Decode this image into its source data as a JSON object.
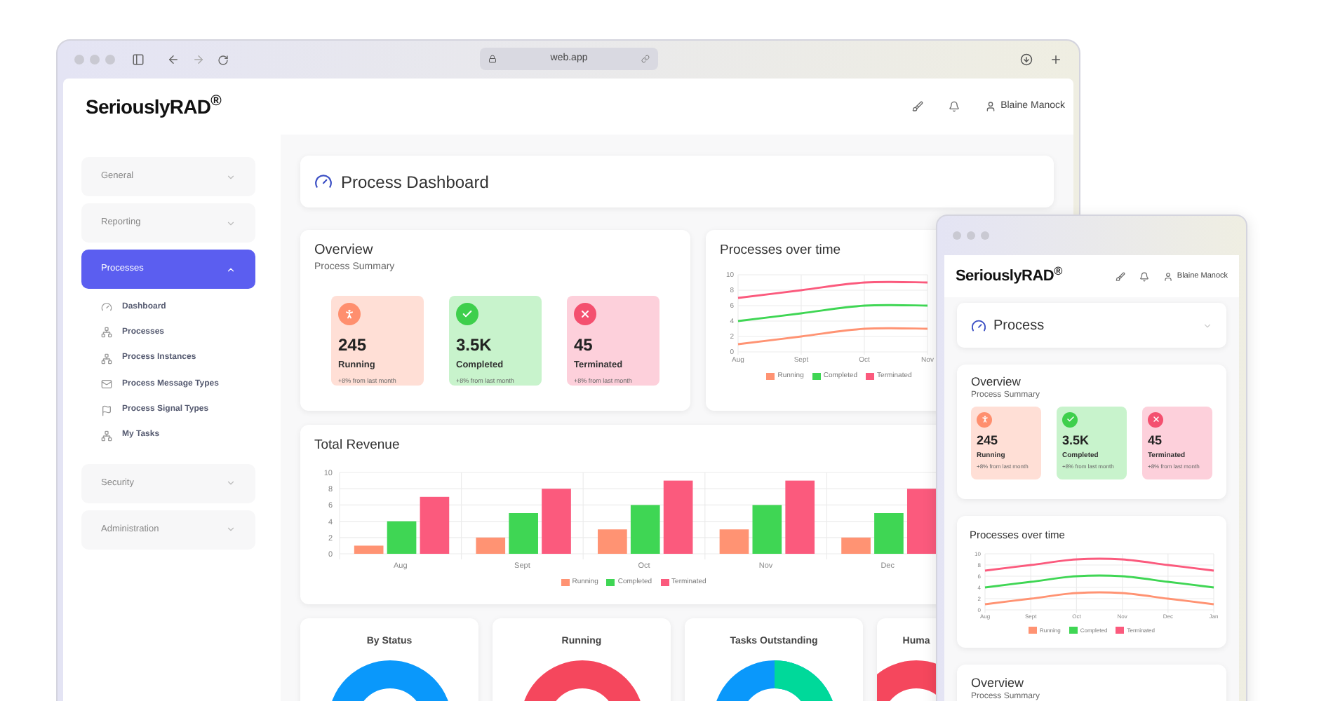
{
  "desktop_window": {
    "address_bar": "web.app",
    "header": {
      "logo": "SeriouslyRAD$^{®}$",
      "user_name": "Blaine Manock"
    },
    "sidebar": {
      "sections": [
        {
          "label": "General",
          "selected": false,
          "expanded": false
        },
        {
          "label": "Reporting",
          "selected": false,
          "expanded": false
        },
        {
          "label": "Processes",
          "selected": true,
          "expanded": true,
          "children": [
            {
              "label": "Dashboard",
              "kind": "gauge"
            },
            {
              "label": "Processes",
              "kind": "hierarchy"
            },
            {
              "label": "Process Instances",
              "kind": "hierarchy"
            },
            {
              "label": "Process Message Types",
              "kind": "mail"
            },
            {
              "label": "Process Signal Types",
              "kind": "flag"
            },
            {
              "label": "My Tasks",
              "kind": "hierarchy"
            }
          ]
        },
        {
          "label": "Security",
          "selected": false,
          "expanded": false
        },
        {
          "label": "Administration",
          "selected": false,
          "expanded": false
        }
      ]
    },
    "page_title": "Process Dashboard",
    "overview": {
      "title": "Overview",
      "subtitle": "Process Summary",
      "stats": [
        {
          "kind": "running",
          "value": "245",
          "label": "Running",
          "change": "+8% from last month"
        },
        {
          "kind": "completed",
          "value": "3.5K",
          "label": "Completed",
          "change": "+8% from last month"
        },
        {
          "kind": "terminated",
          "value": "45",
          "label": "Terminated",
          "change": "+8% from last month"
        }
      ]
    },
    "processes_chart": {
      "title": "Processes over time",
      "chart_data": {
        "type": "line",
        "grid": true,
        "categories": [
          "Aug",
          "Sept",
          "Oct",
          "Nov"
        ],
        "ylim": [
          0,
          10
        ],
        "yticks": [
          0,
          2,
          4,
          6,
          8,
          10
        ],
        "series": [
          {
            "name": "Running",
            "color": "#ff9373",
            "values": [
              1,
              2,
              3,
              3
            ]
          },
          {
            "name": "Completed",
            "color": "#3fd654",
            "values": [
              4,
              5,
              6,
              6
            ]
          },
          {
            "name": "Terminated",
            "color": "#fb5a7d",
            "values": [
              7,
              8,
              9,
              9
            ]
          }
        ]
      }
    },
    "revenue_chart": {
      "title": "Total Revenue",
      "chart_data": {
        "type": "bar",
        "grid": true,
        "categories": [
          "Aug",
          "Sept",
          "Oct",
          "Nov",
          "Dec"
        ],
        "ylim": [
          0,
          10
        ],
        "yticks": [
          0,
          2,
          4,
          6,
          8,
          10
        ],
        "series": [
          {
            "name": "Running",
            "color": "#ff9373",
            "values": [
              1,
              2,
              3,
              3,
              2
            ]
          },
          {
            "name": "Completed",
            "color": "#3fd654",
            "values": [
              4,
              5,
              6,
              6,
              5
            ]
          },
          {
            "name": "Terminated",
            "color": "#fb5a7d",
            "values": [
              7,
              8,
              9,
              9,
              8
            ]
          }
        ]
      }
    },
    "donut_cards": [
      {
        "title": "By Status",
        "kind": "ring",
        "color": "#0a98fb"
      },
      {
        "title": "Running",
        "kind": "ring",
        "color": "#f5475d"
      },
      {
        "title": "Tasks Outstanding",
        "kind": "split"
      },
      {
        "title": "Huma",
        "kind": "ring",
        "color": "#f5475d"
      }
    ]
  },
  "mobile_window": {
    "header": {
      "logo": "SeriouslyRAD$^{®}$",
      "user_name": "Blaine Manock"
    },
    "page_title": "Process",
    "overview": {
      "title": "Overview",
      "subtitle": "Process Summary",
      "stats": [
        {
          "kind": "running",
          "value": "245",
          "label": "Running",
          "change": "+8% from last month"
        },
        {
          "kind": "completed",
          "value": "3.5K",
          "label": "Completed",
          "change": "+8% from last month"
        },
        {
          "kind": "terminated",
          "value": "45",
          "label": "Terminated",
          "change": "+8% from last month"
        }
      ]
    },
    "processes_chart": {
      "title": "Processes over time",
      "chart_data": {
        "type": "line",
        "grid": true,
        "categories": [
          "Aug",
          "Sept",
          "Oct",
          "Nov",
          "Dec",
          "Jan"
        ],
        "ylim": [
          0,
          10
        ],
        "yticks": [
          0,
          2,
          4,
          6,
          8,
          10
        ],
        "series": [
          {
            "name": "Running",
            "color": "#ff9373",
            "values": [
              1,
              2,
              3,
              3,
              2,
              1
            ]
          },
          {
            "name": "Completed",
            "color": "#3fd654",
            "values": [
              4,
              5,
              6,
              6,
              5,
              4
            ]
          },
          {
            "name": "Terminated",
            "color": "#fb5a7d",
            "values": [
              7,
              8,
              9,
              9,
              8,
              7
            ]
          }
        ]
      }
    },
    "second_overview": {
      "title": "Overview",
      "subtitle": "Process Summary"
    }
  }
}
